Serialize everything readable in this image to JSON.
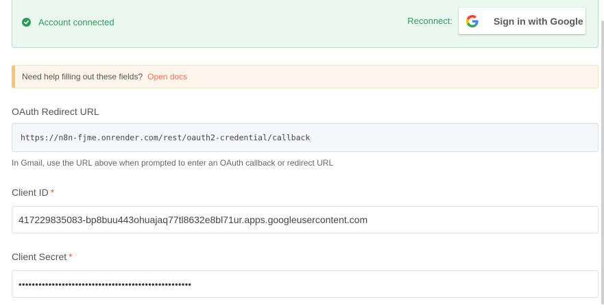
{
  "connected_banner": {
    "status_text": "Account connected",
    "reconnect_label": "Reconnect:",
    "google_button_label": "Sign in with Google"
  },
  "help_banner": {
    "text": "Need help filling out these fields?",
    "link_text": "Open docs"
  },
  "oauth_redirect": {
    "label": "OAuth Redirect URL",
    "value": "https://n8n-fjme.onrender.com/rest/oauth2-credential/callback",
    "hint": "In Gmail, use the URL above when prompted to enter an OAuth callback or redirect URL"
  },
  "client_id": {
    "label": "Client ID",
    "required_mark": "*",
    "value": "417229835083-bp8buu443ohuajaq77tl8632e8bl71ur.apps.googleusercontent.com"
  },
  "client_secret": {
    "label": "Client Secret",
    "required_mark": "*",
    "value": "••••••••••••••••••••••••••••••••••••••••••••••••••••"
  },
  "colors": {
    "success_green": "#2e9a5b",
    "success_bg": "#ebf8f1",
    "warning_bg": "#fef6ea",
    "link_orange": "#ff6d5a",
    "required_red": "#f45a4a"
  },
  "icons": {
    "status": "check-circle-icon",
    "google": "google-g-icon"
  }
}
